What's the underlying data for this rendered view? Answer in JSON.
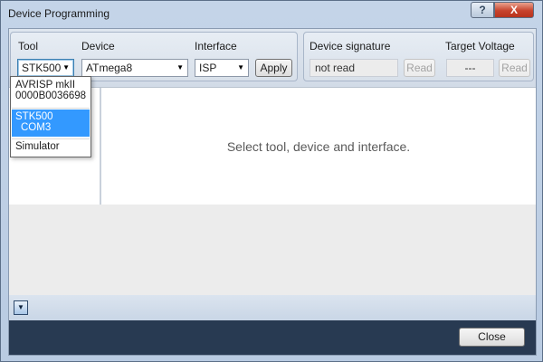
{
  "window": {
    "title": "Device Programming",
    "help_glyph": "?",
    "close_glyph": "X"
  },
  "toolbar": {
    "tool": {
      "label": "Tool",
      "value": "STK500"
    },
    "device": {
      "label": "Device",
      "value": "ATmega8"
    },
    "interface": {
      "label": "Interface",
      "value": "ISP"
    },
    "apply_label": "Apply",
    "signature": {
      "label": "Device signature",
      "value": "not read",
      "read_label": "Read"
    },
    "voltage": {
      "label": "Target Voltage",
      "value": "---",
      "read_label": "Read"
    }
  },
  "dropdown": {
    "items": [
      {
        "line1": "AVRISP mkII",
        "line2": "0000B0036698"
      },
      {
        "line1": "STK500",
        "line2": "COM3",
        "selected": true
      },
      {
        "line1": "Simulator",
        "line2": ""
      }
    ]
  },
  "main": {
    "message": "Select tool, device and interface."
  },
  "footer": {
    "close_label": "Close"
  },
  "icons": {
    "combo_arrow": "▼",
    "expander": "▼"
  },
  "colors": {
    "selection": "#3399ff",
    "footer_bg": "#283a52",
    "close_red": "#c7432d"
  }
}
